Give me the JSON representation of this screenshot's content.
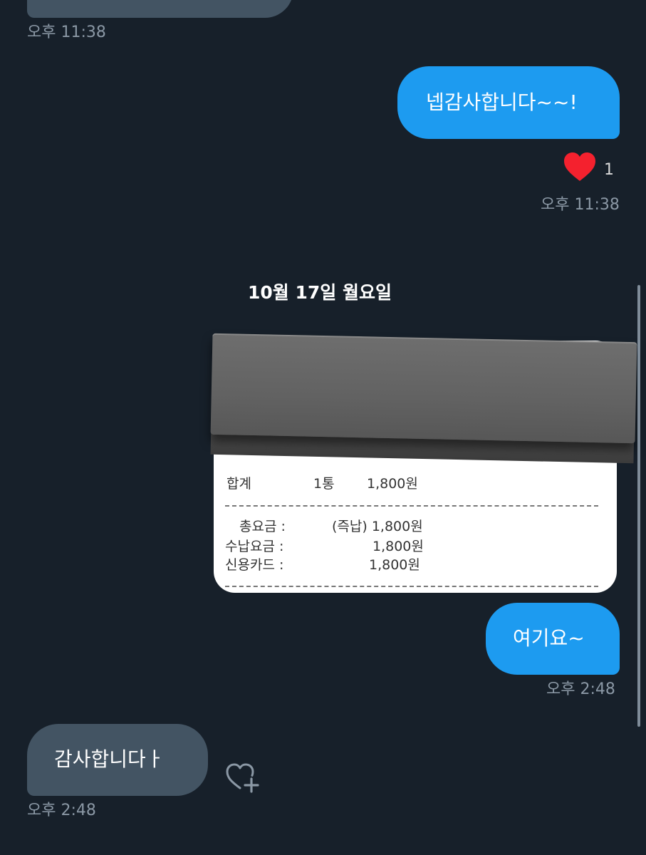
{
  "messages": [
    {
      "time": "오후 11:38"
    },
    {
      "text": "넵감사합니다~~!",
      "reaction_count": "1",
      "time": "오후 11:38"
    },
    {
      "date_separator": "10월 17일 월요일"
    },
    {
      "receipt": {
        "total_label": "합계",
        "total_qty": "1통",
        "total_amount": "1,800원",
        "charge_label": "총요금 :",
        "charge_value": "(즉납) 1,800원",
        "paid_label": "수납요금 :",
        "paid_value": "1,800원",
        "card_label": "신용카드 :",
        "card_value": "1,800원"
      }
    },
    {
      "text": "여기요~",
      "time": "오후 2:48"
    },
    {
      "text": "감사합니다ㅏ",
      "time": "오후 2:48"
    }
  ],
  "colors": {
    "background": "#17202a",
    "outgoing_bubble": "#1d9bf0",
    "incoming_bubble": "#435463",
    "timestamp": "#8b98a5",
    "heart": "#f4212e"
  },
  "icons": [
    "heart-icon",
    "add-reaction-icon"
  ]
}
